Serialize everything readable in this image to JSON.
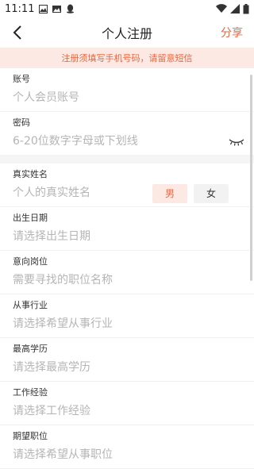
{
  "status": {
    "time": "11:11"
  },
  "header": {
    "title": "个人注册",
    "share_label": "分享"
  },
  "notice": {
    "text": "注册须填写手机号码，请留意短信"
  },
  "fields": [
    {
      "label": "账号",
      "placeholder": "个人会员账号"
    },
    {
      "label": "密码",
      "placeholder": "6-20位数字字母或下划线"
    },
    {
      "label": "真实姓名",
      "placeholder": "个人的真实姓名"
    },
    {
      "label": "出生日期",
      "placeholder": "请选择出生日期"
    },
    {
      "label": "意向岗位",
      "placeholder": "需要寻找的职位名称"
    },
    {
      "label": "从事行业",
      "placeholder": "请选择希望从事行业"
    },
    {
      "label": "最高学历",
      "placeholder": "请选择最高学历"
    },
    {
      "label": "工作经验",
      "placeholder": "请选择工作经验"
    },
    {
      "label": "期望职位",
      "placeholder": "请选择希望从事职位"
    }
  ],
  "gender": {
    "male": "男",
    "female": "女",
    "selected": "男"
  },
  "colors": {
    "accent": "#e8663d",
    "notice_bg": "#fde9e3"
  }
}
